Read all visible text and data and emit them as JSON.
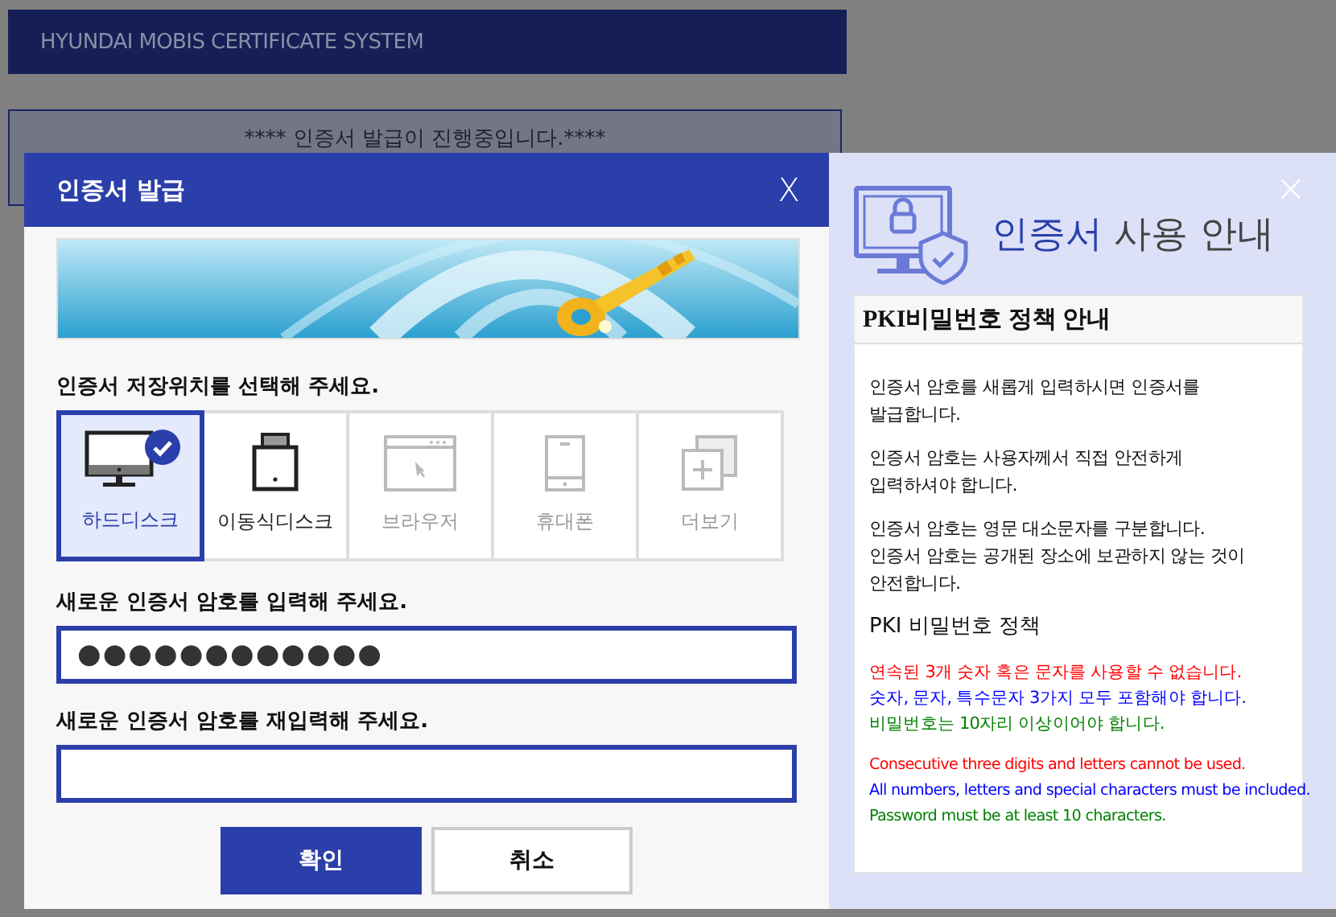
{
  "header": {
    "title": "HYUNDAI MOBIS CERTIFICATE SYSTEM"
  },
  "status": {
    "message": "**** 인증서 발급이 진행중입니다.****"
  },
  "dialog": {
    "title": "인증서 발급",
    "close": "X",
    "location_label": "인증서 저장위치를 선택해 주세요.",
    "locations": [
      {
        "kind": "harddisk",
        "label": "하드디스크",
        "selected": true,
        "disabled": false
      },
      {
        "kind": "usb",
        "label": "이동식디스크",
        "selected": false,
        "disabled": false
      },
      {
        "kind": "browser",
        "label": "브라우저",
        "selected": false,
        "disabled": true
      },
      {
        "kind": "phone",
        "label": "휴대폰",
        "selected": false,
        "disabled": true
      },
      {
        "kind": "more",
        "label": "더보기",
        "selected": false,
        "disabled": true
      }
    ],
    "password_label": "새로운 인증서 암호를 입력해 주세요.",
    "password_value": "●●●●●●●●●●●●",
    "confirm_label": "새로운 인증서 암호를 재입력해 주세요.",
    "buttons": [
      "확인",
      "취소"
    ]
  },
  "guide": {
    "close": "×",
    "title_accent": "인증서",
    "title_rest": "사용 안내",
    "card_title": "PKI비밀번호 정책 안내",
    "paragraphs": [
      [
        "인증서 암호를 새롭게 입력하시면 인증서를",
        "발급합니다."
      ],
      [
        "인증서 암호는 사용자께서 직접 안전하게",
        "입력하셔야 합니다."
      ],
      [
        "인증서 암호는 영문 대소문자를 구분합니다.",
        "인증서 암호는 공개된 장소에 보관하지 않는 것이",
        "안전합니다."
      ]
    ],
    "policy_title": "PKI 비밀번호 정책",
    "rules_ko": [
      {
        "text": "연속된 3개 숫자 혹은 문자를 사용할 수 없습니다.",
        "color": "#ff0000"
      },
      {
        "text": "숫자, 문자, 특수문자 3가지 모두 포함해야 합니다.",
        "color": "#0000ff"
      },
      {
        "text": "비밀번호는 10자리 이상이어야 합니다.",
        "color": "#008000"
      }
    ],
    "rules_en": [
      {
        "text": "Consecutive three digits and letters cannot be used.",
        "color": "#ff0000"
      },
      {
        "text": "All numbers, letters and special characters must be included.",
        "color": "#0000ff"
      },
      {
        "text": "Password must be at least 10 characters.",
        "color": "#008000"
      }
    ]
  }
}
